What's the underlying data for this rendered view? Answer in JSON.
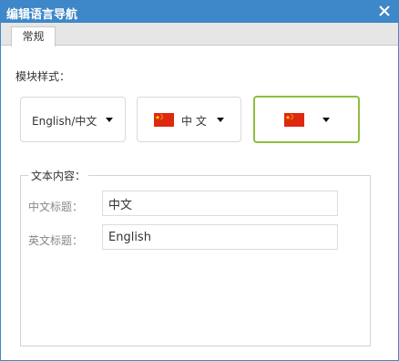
{
  "dialog": {
    "title": "编辑语言导航",
    "close_icon": "close-icon"
  },
  "tabs": [
    {
      "label": "常规",
      "active": true
    }
  ],
  "style_section": {
    "label": "模块样式：",
    "options": [
      {
        "text": "English/中文",
        "flag": null,
        "selected": false
      },
      {
        "text": "中 文",
        "flag": "china-flag-icon",
        "selected": false
      },
      {
        "text": "",
        "flag": "china-flag-icon",
        "selected": true
      }
    ],
    "selected_border_color": "#8cbf3f"
  },
  "content_section": {
    "legend": "文本内容：",
    "fields": [
      {
        "label": "中文标题：",
        "value": "中文"
      },
      {
        "label": "英文标题：",
        "value": "English"
      }
    ]
  },
  "colors": {
    "titlebar": "#3e87c8",
    "flag_red": "#de2910",
    "flag_yellow": "#ffde00"
  }
}
